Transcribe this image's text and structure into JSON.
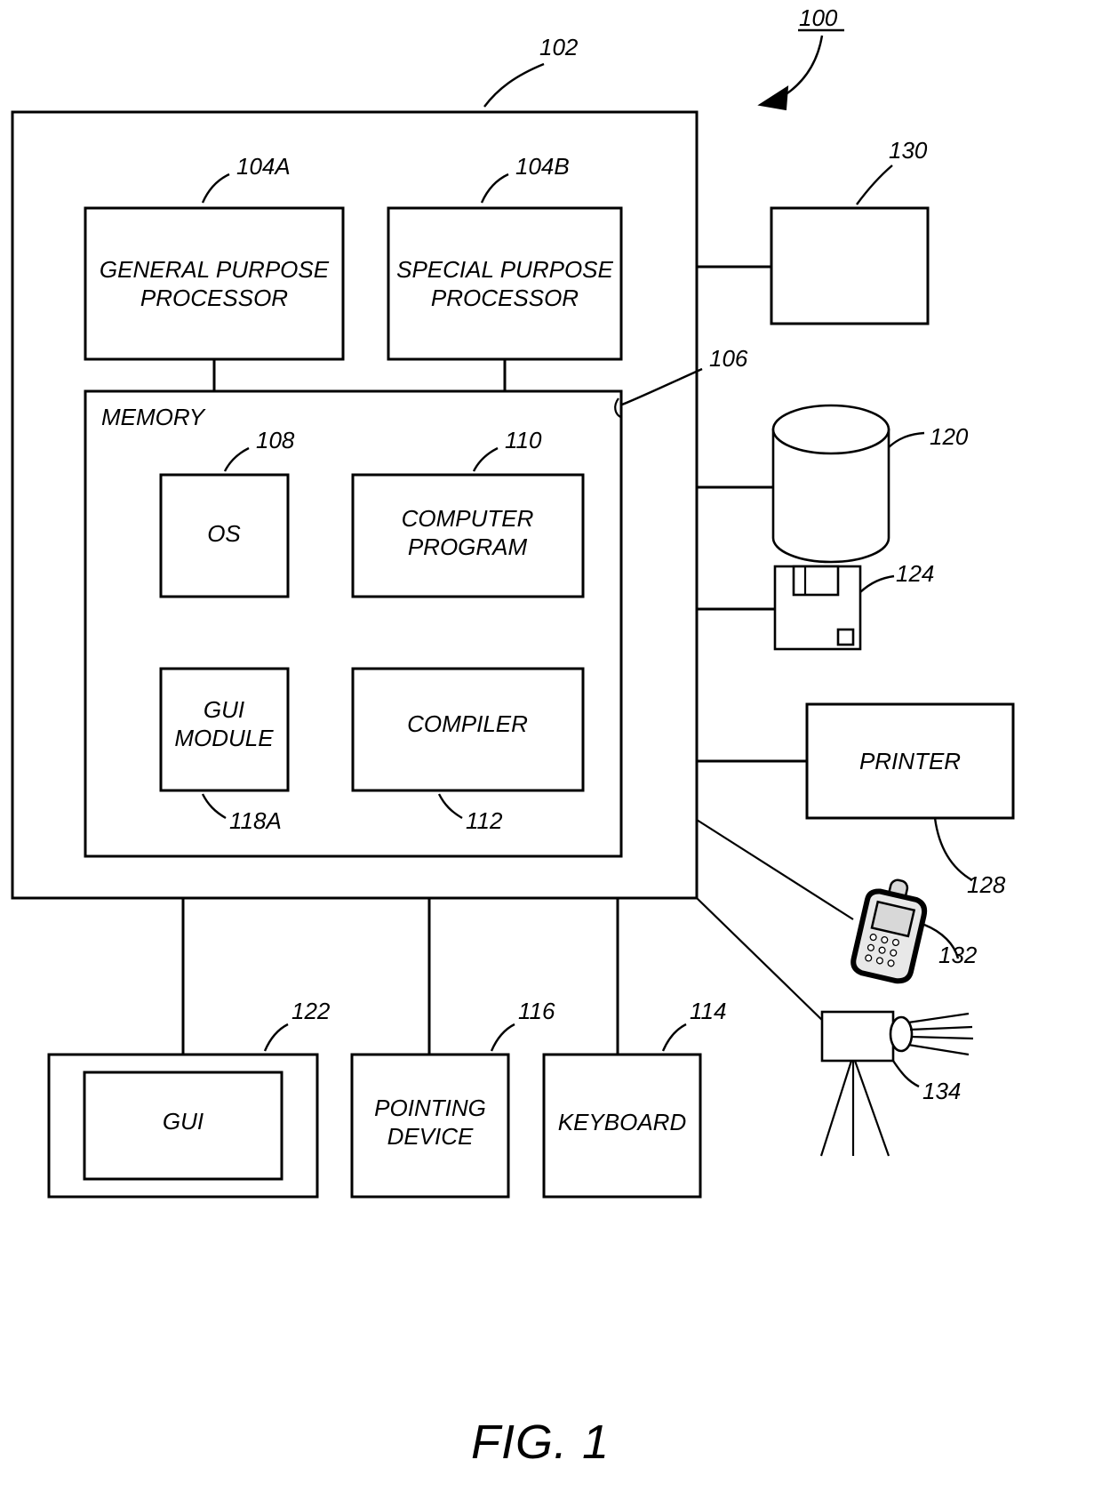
{
  "figure": {
    "caption": "FIG. 1",
    "system_ref": "100"
  },
  "boxes": {
    "computer": {
      "ref": "102",
      "label": ""
    },
    "general_processor": {
      "ref": "104A",
      "label": "GENERAL PURPOSE PROCESSOR"
    },
    "special_processor": {
      "ref": "104B",
      "label": "SPECIAL PURPOSE PROCESSOR"
    },
    "memory": {
      "ref": "106",
      "label": "MEMORY"
    },
    "os": {
      "ref": "108",
      "label": "OS"
    },
    "computer_program": {
      "ref": "110",
      "label": "COMPUTER PROGRAM"
    },
    "gui_module": {
      "ref": "118A",
      "label": "GUI MODULE"
    },
    "compiler": {
      "ref": "112",
      "label": "COMPILER"
    },
    "gui": {
      "ref": "122",
      "label": "GUI"
    },
    "pointing_device": {
      "ref": "116",
      "label": "POINTING DEVICE"
    },
    "keyboard": {
      "ref": "114",
      "label": "KEYBOARD"
    },
    "printer": {
      "ref": "128",
      "label": "PRINTER"
    },
    "unnamed_device": {
      "ref": "130",
      "label": ""
    },
    "data_storage": {
      "ref": "120",
      "label": ""
    },
    "removable_media": {
      "ref": "124",
      "label": ""
    },
    "mobile_phone": {
      "ref": "132",
      "label": ""
    },
    "camera": {
      "ref": "134",
      "label": ""
    }
  },
  "text_lines": {
    "general_processor_l1": "GENERAL PURPOSE",
    "general_processor_l2": "PROCESSOR",
    "special_processor_l1": "SPECIAL PURPOSE",
    "special_processor_l2": "PROCESSOR",
    "computer_program_l1": "COMPUTER",
    "computer_program_l2": "PROGRAM",
    "gui_module_l1": "GUI",
    "gui_module_l2": "MODULE",
    "pointing_device_l1": "POINTING",
    "pointing_device_l2": "DEVICE",
    "memory_label": "MEMORY",
    "os_label": "OS",
    "compiler_label": "COMPILER",
    "gui_label": "GUI",
    "keyboard_label": "KEYBOARD",
    "printer_label": "PRINTER"
  },
  "colors": {
    "line": "#000000",
    "background": "#ffffff",
    "device_shade": "#e8e8e8"
  }
}
